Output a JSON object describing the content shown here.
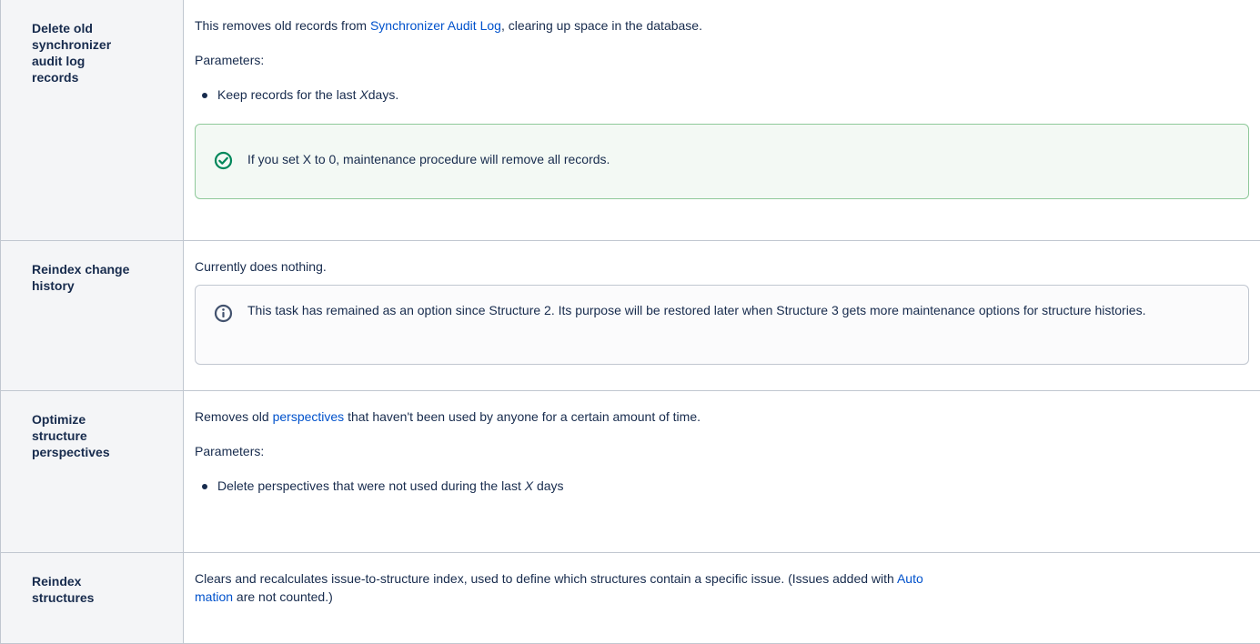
{
  "rows": [
    {
      "title": "Delete old synchronizer audit log records",
      "desc_before": "This removes old records from ",
      "desc_link": "Synchronizer Audit Log",
      "desc_after": ", clearing up space in the database.",
      "params_label": "Parameters:",
      "bullet_before": "Keep records for the last ",
      "bullet_var": "X",
      "bullet_after": "days.",
      "panel_icon": "check-circle-icon",
      "panel_text": "If you set X to 0, maintenance procedure will remove all records."
    },
    {
      "title": "Reindex change history",
      "desc": "Currently does nothing.",
      "panel_icon": "info-circle-icon",
      "panel_text": "This task has remained as an option since Structure 2. Its purpose will be restored later when Structure 3 gets more maintenance options for structure histories."
    },
    {
      "title": "Optimize structure perspectives",
      "desc_before": "Removes old ",
      "desc_link": "perspectives",
      "desc_after": " that haven't been used by anyone for a certain amount of time.",
      "params_label": "Parameters:",
      "bullet_before": "Delete perspectives that were not used during the last ",
      "bullet_var": "X",
      "bullet_after": " days"
    },
    {
      "title": "Reindex structures",
      "desc_before": "Clears and recalculates issue-to-structure index, used to define which structures contain a specific issue. (Issues added with ",
      "desc_link_1": "Auto",
      "desc_link_2": "mation",
      "desc_after": " are not counted.)"
    }
  ],
  "colors": {
    "link": "#0052cc",
    "tip_border": "#8fc99a",
    "tip_icon": "#00875a",
    "info_border": "#c1c7d0",
    "info_icon": "#42526e",
    "header_bg": "#f4f5f7"
  }
}
